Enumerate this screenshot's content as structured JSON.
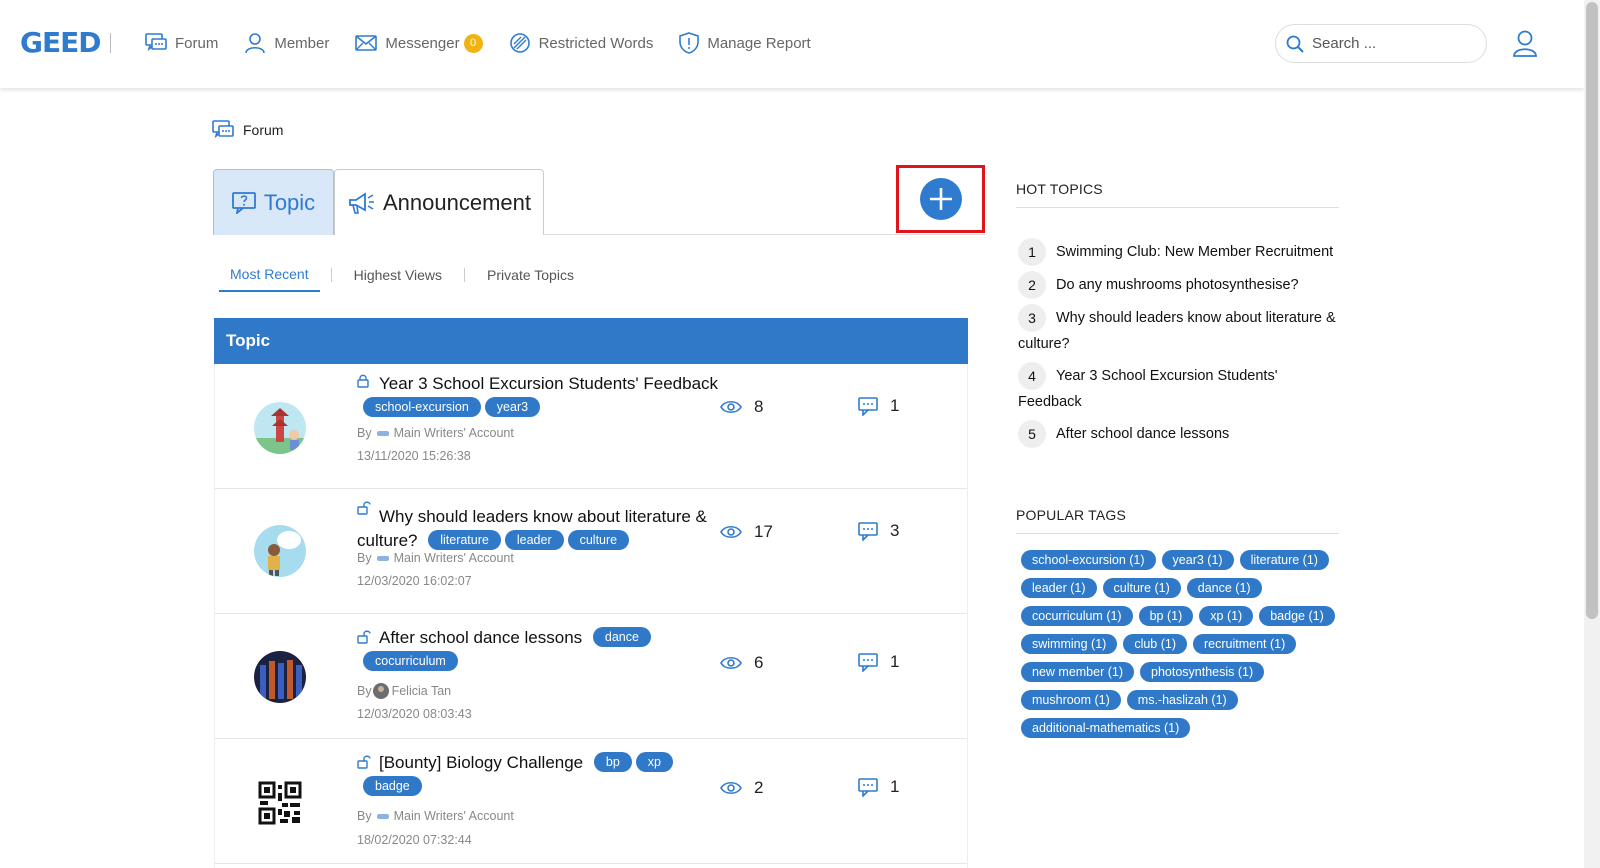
{
  "header": {
    "logo": "GEED",
    "nav": [
      {
        "label": "Forum",
        "icon": "forum-icon"
      },
      {
        "label": "Member",
        "icon": "member-icon"
      },
      {
        "label": "Messenger",
        "icon": "envelope-icon",
        "badge": "0"
      },
      {
        "label": "Restricted Words",
        "icon": "restricted-icon"
      },
      {
        "label": "Manage Report",
        "icon": "shield-icon"
      }
    ],
    "search_placeholder": "Search ..."
  },
  "breadcrumb": "Forum",
  "tabs": {
    "topic": "Topic",
    "announcement": "Announcement"
  },
  "subtabs": [
    "Most Recent",
    "Highest Views",
    "Private Topics"
  ],
  "table": {
    "header": "Topic",
    "by_label": "By",
    "rows": [
      {
        "title": "Year 3 School Excursion Students' Feedback",
        "tags": [
          "school-excursion",
          "year3"
        ],
        "author": "Main Writers' Account",
        "date": "13/11/2020 15:26:38",
        "views": "8",
        "replies": "1"
      },
      {
        "title": "Why should leaders know about literature & culture?",
        "tags": [
          "literature",
          "leader",
          "culture"
        ],
        "author": "Main Writers' Account",
        "date": "12/03/2020 16:02:07",
        "views": "17",
        "replies": "3"
      },
      {
        "title": "After school dance lessons",
        "tags": [
          "dance",
          "cocurriculum"
        ],
        "author": "Felicia Tan",
        "date": "12/03/2020 08:03:43",
        "views": "6",
        "replies": "1"
      },
      {
        "title": "[Bounty] Biology Challenge",
        "tags": [
          "bp",
          "xp",
          "badge"
        ],
        "author": "Main Writers' Account",
        "date": "18/02/2020 07:32:44",
        "views": "2",
        "replies": "1"
      }
    ]
  },
  "hot_topics": {
    "title": "HOT TOPICS",
    "items": [
      {
        "num": "1",
        "text": "Swimming Club: New Member Recruitment"
      },
      {
        "num": "2",
        "text": "Do any mushrooms photosynthesise?"
      },
      {
        "num": "3",
        "text": "Why should leaders know about literature & culture?"
      },
      {
        "num": "4",
        "text": "Year 3 School Excursion Students' Feedback"
      },
      {
        "num": "5",
        "text": "After school dance lessons"
      }
    ]
  },
  "popular_tags": {
    "title": "POPULAR TAGS",
    "items": [
      "school-excursion (1)",
      "year3 (1)",
      "literature (1)",
      "leader (1)",
      "culture (1)",
      "dance (1)",
      "cocurriculum (1)",
      "bp (1)",
      "xp (1)",
      "badge (1)",
      "swimming (1)",
      "club (1)",
      "recruitment (1)",
      "new member (1)",
      "photosynthesis (1)",
      "mushroom (1)",
      "ms.-haslizah (1)",
      "additional-mathematics (1)"
    ]
  },
  "colors": {
    "accent": "#2f79c8",
    "highlight_box": "#e0141c",
    "badge": "#f0b312"
  }
}
